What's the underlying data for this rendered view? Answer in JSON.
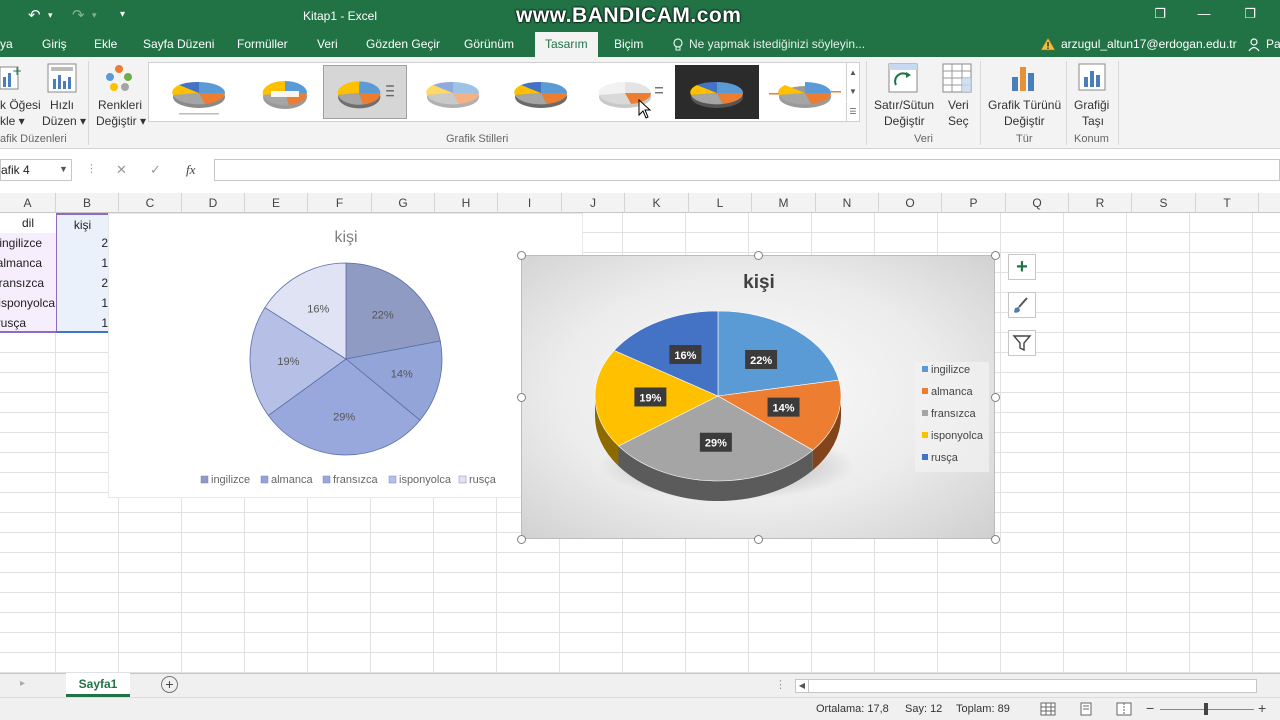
{
  "window": {
    "title": "Kitap1 - Excel",
    "watermark": "www.BANDICAM.com",
    "undo_icon": "↶",
    "redo_icon": "↷",
    "customize_icon": "▾",
    "restore_icon": "❐",
    "minimize_icon": "—"
  },
  "ribbon_tabs": [
    {
      "label": "ya"
    },
    {
      "label": "Giriş"
    },
    {
      "label": "Ekle"
    },
    {
      "label": "Sayfa Düzeni"
    },
    {
      "label": "Formüller"
    },
    {
      "label": "Veri"
    },
    {
      "label": "Gözden Geçir"
    },
    {
      "label": "Görünüm"
    },
    {
      "label": "Tasarım"
    },
    {
      "label": "Biçim"
    }
  ],
  "tell_me": {
    "placeholder": "Ne yapmak istediğinizi söyleyin..."
  },
  "account": {
    "email": "arzugul_altun17@erdogan.edu.tr",
    "share": "Pa"
  },
  "ribbon": {
    "add_element": {
      "line1": "k Öğesi",
      "line2": "kle ▾"
    },
    "quick_layout": {
      "line1": "Hızlı",
      "line2": "Düzen ▾"
    },
    "layouts_group": "afik Düzenleri",
    "change_colors": {
      "line1": "Renkleri",
      "line2": "Değiştir ▾"
    },
    "styles_group": "Grafik Stilleri",
    "switch_row_col": {
      "line1": "Satır/Sütun",
      "line2": "Değiştir"
    },
    "select_data": {
      "line1": "Veri",
      "line2": "Seç"
    },
    "data_group": "Veri",
    "change_type": {
      "line1": "Grafik Türünü",
      "line2": "Değiştir"
    },
    "type_group": "Tür",
    "move_chart": {
      "line1": "Grafiği",
      "line2": "Taşı"
    },
    "location_group": "Konum"
  },
  "formula_bar": {
    "name_box": "afik 4",
    "cancel": "✕",
    "enter": "✓",
    "fx": "fx",
    "value": ""
  },
  "columns": [
    "A",
    "B",
    "C",
    "D",
    "E",
    "F",
    "G",
    "H",
    "I",
    "J",
    "K",
    "L",
    "M",
    "N",
    "O",
    "P",
    "Q",
    "R",
    "S",
    "T"
  ],
  "sheet": {
    "header": {
      "a": "dil",
      "b": "kişi"
    },
    "rows": [
      {
        "a": "ingilizce",
        "b": "2"
      },
      {
        "a": "almanca",
        "b": "1"
      },
      {
        "a": "fransızca",
        "b": "2"
      },
      {
        "a": "isponyolca",
        "b": "1"
      },
      {
        "a": "rusça",
        "b": "1"
      }
    ]
  },
  "chart_data": [
    {
      "type": "pie",
      "title": "kişi",
      "categories": [
        "ingilizce",
        "almanca",
        "fransızca",
        "isponyolca",
        "rusça"
      ],
      "values": [
        22,
        14,
        29,
        19,
        16
      ],
      "data_labels": [
        "22%",
        "14%",
        "29%",
        "19%",
        "16%"
      ],
      "colors": [
        "#8f9bc3",
        "#93a5d8",
        "#98a8dc",
        "#b6c0e6",
        "#dfe3f3"
      ],
      "legend": "bottom"
    },
    {
      "type": "pie",
      "title": "kişi",
      "categories": [
        "ingilizce",
        "almanca",
        "fransızca",
        "isponyolca",
        "rusça"
      ],
      "values": [
        22,
        14,
        29,
        19,
        16
      ],
      "data_labels": [
        "22%",
        "14%",
        "29%",
        "19%",
        "16%"
      ],
      "colors": [
        "#5b9bd5",
        "#ed7d31",
        "#a5a5a5",
        "#ffc000",
        "#4472c4"
      ],
      "legend": "right",
      "style": "3d"
    }
  ],
  "chart_tools": {
    "add_icon": "+",
    "style_icon": "brush",
    "filter_icon": "filter"
  },
  "sheet_tabs": {
    "active": "Sayfa1",
    "add_icon": "+"
  },
  "status": {
    "average": "Ortalama: 17,8",
    "count": "Say: 12",
    "sum": "Toplam: 89"
  }
}
